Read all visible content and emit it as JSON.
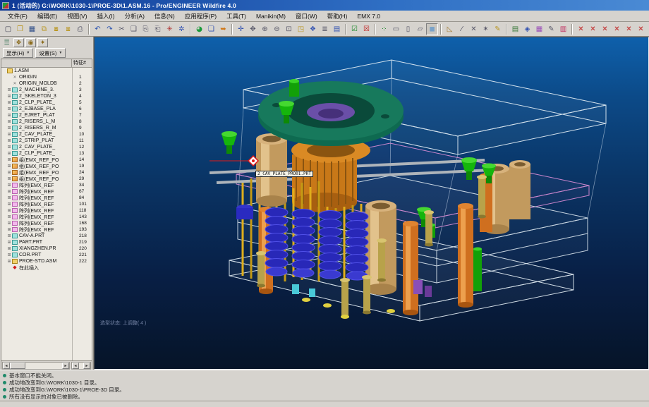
{
  "window": {
    "title": "1 (活动的) G:\\WORK\\1030-1\\PROE-3D\\1.ASM.16 - Pro/ENGINEER Wildfire 4.0"
  },
  "menu": {
    "items": [
      "文件(F)",
      "编辑(E)",
      "视图(V)",
      "插入(I)",
      "分析(A)",
      "信息(N)",
      "应用程序(P)",
      "工具(T)",
      "Manikin(M)",
      "窗口(W)",
      "帮助(H)",
      "EMX 7.0"
    ]
  },
  "toolbar": {
    "icons": [
      {
        "n": "new-file",
        "g": "▢",
        "c": "#445"
      },
      {
        "n": "open-file",
        "g": "❐",
        "c": "#b8941c"
      },
      {
        "n": "save-file",
        "g": "▦",
        "c": "#33518a"
      },
      {
        "n": "save-copy",
        "g": "⧉",
        "c": "#b8941c"
      },
      {
        "n": "backup",
        "g": "⧇",
        "c": "#b8941c"
      },
      {
        "n": "mirror-copy",
        "g": "⧆",
        "c": "#b8941c"
      },
      {
        "n": "print",
        "g": "⎙",
        "c": "#556"
      },
      {
        "sep": true
      },
      {
        "n": "undo",
        "g": "↶",
        "c": "#2a52b0"
      },
      {
        "n": "redo",
        "g": "↷",
        "c": "#2a52b0"
      },
      {
        "n": "cut",
        "g": "✂",
        "c": "#556"
      },
      {
        "n": "copy",
        "g": "❑",
        "c": "#556"
      },
      {
        "n": "paste",
        "g": "⎘",
        "c": "#556"
      },
      {
        "n": "paste-special",
        "g": "⎗",
        "c": "#556"
      },
      {
        "n": "regenerate",
        "g": "✳",
        "c": "#b03030"
      },
      {
        "n": "auto-regenerate",
        "g": "✲",
        "c": "#3050b0"
      },
      {
        "sep": true
      },
      {
        "n": "render-view",
        "g": "◕",
        "c": "#1a9a3a"
      },
      {
        "n": "model-window",
        "g": "❏",
        "c": "#3050b0"
      },
      {
        "n": "repaint",
        "g": "➥",
        "c": "#d07818"
      },
      {
        "sep": true
      },
      {
        "n": "spin-center",
        "g": "✛",
        "c": "#3050b0"
      },
      {
        "n": "pan-view",
        "g": "✥",
        "c": "#556"
      },
      {
        "n": "zoom-in",
        "g": "⊕",
        "c": "#556"
      },
      {
        "n": "zoom-out",
        "g": "⊖",
        "c": "#556"
      },
      {
        "n": "refit",
        "g": "⊡",
        "c": "#556"
      },
      {
        "n": "orient-view",
        "g": "◳",
        "c": "#b8941c"
      },
      {
        "n": "view-manager",
        "g": "❖",
        "c": "#3050b0"
      },
      {
        "n": "layer-list",
        "g": "≣",
        "c": "#556"
      },
      {
        "n": "layers",
        "g": "▤",
        "c": "#3050b0"
      },
      {
        "sep": true
      },
      {
        "n": "activate-window",
        "g": "☑",
        "c": "#1a8a2a"
      },
      {
        "n": "close-window",
        "g": "☒",
        "c": "#c02020"
      },
      {
        "sep": true
      },
      {
        "n": "datum-display",
        "g": "⁘",
        "c": "#1a8a2a"
      },
      {
        "n": "wireframe-display",
        "g": "▭",
        "c": "#556"
      },
      {
        "n": "hidden-line-display",
        "g": "▯",
        "c": "#556"
      },
      {
        "n": "no-hidden-display",
        "g": "▱",
        "c": "#556"
      },
      {
        "n": "shaded-display",
        "g": "◼",
        "c": "#7aa2c8",
        "pressed": true
      },
      {
        "sep": true
      },
      {
        "n": "datum-plane-toggle",
        "g": "◺",
        "c": "#a0762a"
      },
      {
        "n": "datum-axis-toggle",
        "g": "⁄",
        "c": "#556"
      },
      {
        "n": "datum-point-toggle",
        "g": "✕",
        "c": "#556"
      },
      {
        "n": "csys-toggle",
        "g": "✶",
        "c": "#556"
      },
      {
        "n": "annotation-edit",
        "g": "✎",
        "c": "#b8941c"
      },
      {
        "sep": true
      },
      {
        "n": "emx-notes",
        "g": "▤",
        "c": "#3a7a3a"
      },
      {
        "n": "emx-preview",
        "g": "◈",
        "c": "#3050b0"
      },
      {
        "n": "emx-grid",
        "g": "▦",
        "c": "#9a4fb8"
      },
      {
        "n": "emx-draw",
        "g": "✎",
        "c": "#556"
      },
      {
        "n": "emx-colorbars",
        "g": "▥",
        "c": "#c03060"
      },
      {
        "sep": true
      },
      {
        "n": "emx-screws",
        "g": "✕",
        "c": "#c02020"
      },
      {
        "n": "emx-pins",
        "g": "✕",
        "c": "#c02020"
      },
      {
        "n": "emx-springs",
        "g": "✕",
        "c": "#c02020"
      },
      {
        "n": "emx-components",
        "g": "✕",
        "c": "#c02020"
      },
      {
        "n": "emx-ejector",
        "g": "✕",
        "c": "#c02020"
      },
      {
        "n": "emx-cooling",
        "g": "✕",
        "c": "#c02020"
      }
    ]
  },
  "tree_panel": {
    "nav_icons": [
      {
        "n": "model-tree-toggle",
        "g": "☰",
        "flat": true
      },
      {
        "n": "folder-browser-tab",
        "g": "❖"
      },
      {
        "n": "favorites-tab",
        "g": "◉"
      },
      {
        "n": "connections-tab",
        "g": "✦"
      }
    ],
    "show_button": {
      "label": "显示(H)",
      "arrow": "▼"
    },
    "settings_button": {
      "label": "设置(S)",
      "arrow": "▼"
    },
    "column_header": "特征#",
    "expand_glyph": "⊞",
    "rows": [
      {
        "icon": "asmroot",
        "expand": false,
        "label": "1.ASM",
        "num": "",
        "indent": 0
      },
      {
        "icon": "datum",
        "expand": false,
        "label": "ORIGIN",
        "num": "1",
        "indent": 1
      },
      {
        "icon": "datum",
        "expand": false,
        "label": "ORIGIN_MOLDB",
        "num": "2",
        "indent": 1
      },
      {
        "icon": "part",
        "expand": true,
        "label": "2_MACHINE_3.",
        "num": "3",
        "indent": 1
      },
      {
        "icon": "part",
        "expand": true,
        "label": "2_SKELETON_3",
        "num": "4",
        "indent": 1
      },
      {
        "icon": "part",
        "expand": true,
        "label": "2_CLP_PLATE_",
        "num": "5",
        "indent": 1
      },
      {
        "icon": "part",
        "expand": true,
        "label": "2_EJBASE_PLA",
        "num": "6",
        "indent": 1
      },
      {
        "icon": "part",
        "expand": true,
        "label": "2_EJRET_PLAT",
        "num": "7",
        "indent": 1
      },
      {
        "icon": "part",
        "expand": true,
        "label": "2_RISERS_L_M",
        "num": "8",
        "indent": 1
      },
      {
        "icon": "part",
        "expand": true,
        "label": "2_RISERS_R_M",
        "num": "9",
        "indent": 1
      },
      {
        "icon": "part",
        "expand": true,
        "label": "2_CAV_PLATE_",
        "num": "10",
        "indent": 1
      },
      {
        "icon": "part",
        "expand": true,
        "label": "2_STRIP_PLAT",
        "num": "11",
        "indent": 1
      },
      {
        "icon": "part",
        "expand": true,
        "label": "2_CAV_PLATE_",
        "num": "12",
        "indent": 1
      },
      {
        "icon": "part",
        "expand": true,
        "label": "2_CLP_PLATE_",
        "num": "13",
        "indent": 1
      },
      {
        "icon": "group",
        "expand": true,
        "label": "组(EMX_REF_PO",
        "num": "14",
        "indent": 1
      },
      {
        "icon": "group",
        "expand": true,
        "label": "组(EMX_REF_PO",
        "num": "19",
        "indent": 1
      },
      {
        "icon": "group",
        "expand": true,
        "label": "组(EMX_REF_PO",
        "num": "24",
        "indent": 1
      },
      {
        "icon": "group",
        "expand": true,
        "label": "组(EMX_REF_PO",
        "num": "29",
        "indent": 1
      },
      {
        "icon": "pattern",
        "expand": true,
        "label": "阵列(EMX_REF",
        "num": "34",
        "indent": 1
      },
      {
        "icon": "pattern",
        "expand": true,
        "label": "阵列(EMX_REF",
        "num": "67",
        "indent": 1
      },
      {
        "icon": "pattern",
        "expand": true,
        "label": "阵列(EMX_REF",
        "num": "84",
        "indent": 1
      },
      {
        "icon": "pattern",
        "expand": true,
        "label": "阵列(EMX_REF",
        "num": "101",
        "indent": 1
      },
      {
        "icon": "pattern",
        "expand": true,
        "label": "阵列(EMX_REF",
        "num": "118",
        "indent": 1
      },
      {
        "icon": "pattern",
        "expand": true,
        "label": "阵列(EMX_REF",
        "num": "143",
        "indent": 1
      },
      {
        "icon": "pattern",
        "expand": true,
        "label": "阵列(EMX_REF",
        "num": "168",
        "indent": 1
      },
      {
        "icon": "pattern",
        "expand": true,
        "label": "阵列(EMX_REF",
        "num": "193",
        "indent": 1
      },
      {
        "icon": "part",
        "expand": true,
        "label": "CAV-A.PRT",
        "num": "218",
        "indent": 1
      },
      {
        "icon": "part",
        "expand": true,
        "label": "PART.PRT",
        "num": "219",
        "indent": 1
      },
      {
        "icon": "part",
        "expand": true,
        "label": "XIANGZHEN.PR",
        "num": "220",
        "indent": 1
      },
      {
        "icon": "part",
        "expand": true,
        "label": "COR.PRT",
        "num": "221",
        "indent": 1
      },
      {
        "icon": "asm",
        "expand": true,
        "label": "PROE-STD.ASM",
        "num": "222",
        "indent": 1
      },
      {
        "icon": "insert",
        "expand": false,
        "label": "在此插入",
        "num": "",
        "indent": 1
      }
    ]
  },
  "viewport": {
    "selection_label": "2_CAV_PLATE_PRO01.PRT",
    "status_text": "选型状态: 上调整( 4 )",
    "bg_top": "#0e60ab",
    "bg_bottom": "#061428",
    "colors": {
      "wire_white": "#e8f2f8",
      "wire_pink": "#df8fd8",
      "ring_green": "#15795c",
      "funnel_green": "#17b70c",
      "bushing_tan": "#cfa76a",
      "pillar_orange": "#d2711c",
      "spring_blue": "#2a2ac8",
      "pin_gold": "#dfae1c",
      "bolt_tan": "#bda84e",
      "marker_red": "#e01818"
    }
  },
  "status_messages": [
    "基本窗口不能关闭。",
    "成功地改变到G:\\WORK\\1030-1 目录。",
    "成功地改变到G:\\WORK\\1030-1\\PROE-3D 目录。",
    "所有没有显示的对象已被删除。"
  ]
}
